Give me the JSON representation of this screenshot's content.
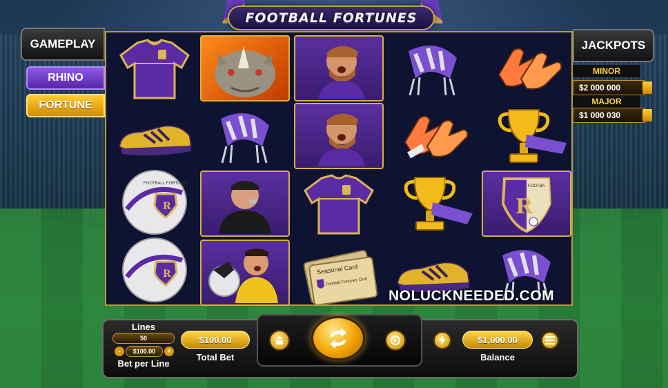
{
  "game": {
    "title": "FOOTBALL FORTUNES",
    "watermark": "NOLUCKNEEDED.COM"
  },
  "left_menu": {
    "gameplay_label": "GAMEPLAY",
    "modes": [
      "RHINO",
      "FORTUNE"
    ],
    "active_mode": "FORTUNE"
  },
  "jackpots": {
    "title": "JACKPOTS",
    "tiers": [
      {
        "label": "MINOR",
        "value": "$2 000 000"
      },
      {
        "label": "MAJOR",
        "value": "$1 000 030"
      }
    ]
  },
  "reels": {
    "columns": 5,
    "rows": 4,
    "symbols": [
      [
        "jersey",
        "sneaker",
        "ball",
        "ball"
      ],
      [
        "rhino",
        "scarf",
        "referee",
        "goalkeeper"
      ],
      [
        "player",
        "player",
        "jersey",
        "seasonal-card"
      ],
      [
        "scarf",
        "gloves",
        "trophy",
        "sneaker"
      ],
      [
        "gloves",
        "trophy",
        "club-crest",
        "scarf"
      ]
    ],
    "card_text": {
      "title": "Seasonal Card",
      "club": "Football Fortunes Club"
    },
    "ball_text": "FOOTBALL FORTUNES",
    "crest_text": "FOOTBA"
  },
  "controls": {
    "lines_label": "Lines",
    "lines_value": "50",
    "bet_per_line_value": "$100.00",
    "bet_per_line_label": "Bet per Line",
    "total_bet_value": "$100.00",
    "total_bet_label": "Total Bet",
    "balance_value": "$1,000.00",
    "balance_label": "Balance",
    "minus": "-",
    "plus": "+"
  },
  "colors": {
    "gold": "#d6b243",
    "purple": "#5a2fa0",
    "reel_bg": "#0d1330"
  }
}
